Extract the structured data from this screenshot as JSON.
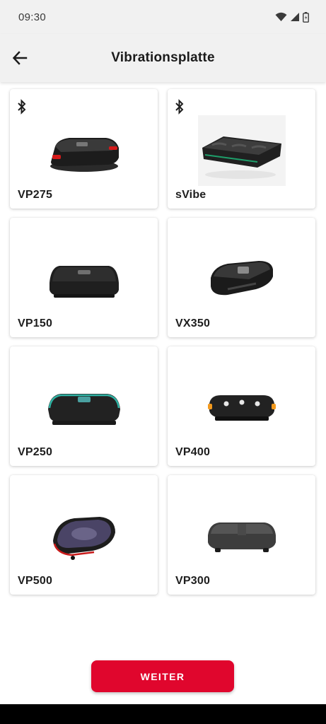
{
  "status": {
    "time": "09:30",
    "icons": [
      "wifi-icon",
      "signal-icon",
      "battery-icon"
    ]
  },
  "appbar": {
    "title": "Vibrationsplatte",
    "back_icon": "arrow-back-icon"
  },
  "products": [
    {
      "label": "VP275",
      "bluetooth": true
    },
    {
      "label": "sVibe",
      "bluetooth": true
    },
    {
      "label": "VP150",
      "bluetooth": false
    },
    {
      "label": "VX350",
      "bluetooth": false
    },
    {
      "label": "VP250",
      "bluetooth": false
    },
    {
      "label": "VP400",
      "bluetooth": false
    },
    {
      "label": "VP500",
      "bluetooth": false
    },
    {
      "label": "VP300",
      "bluetooth": false
    }
  ],
  "cta": {
    "label": "WEITER"
  },
  "colors": {
    "accent": "#e0062d",
    "appbar": "#f1f1f1"
  }
}
